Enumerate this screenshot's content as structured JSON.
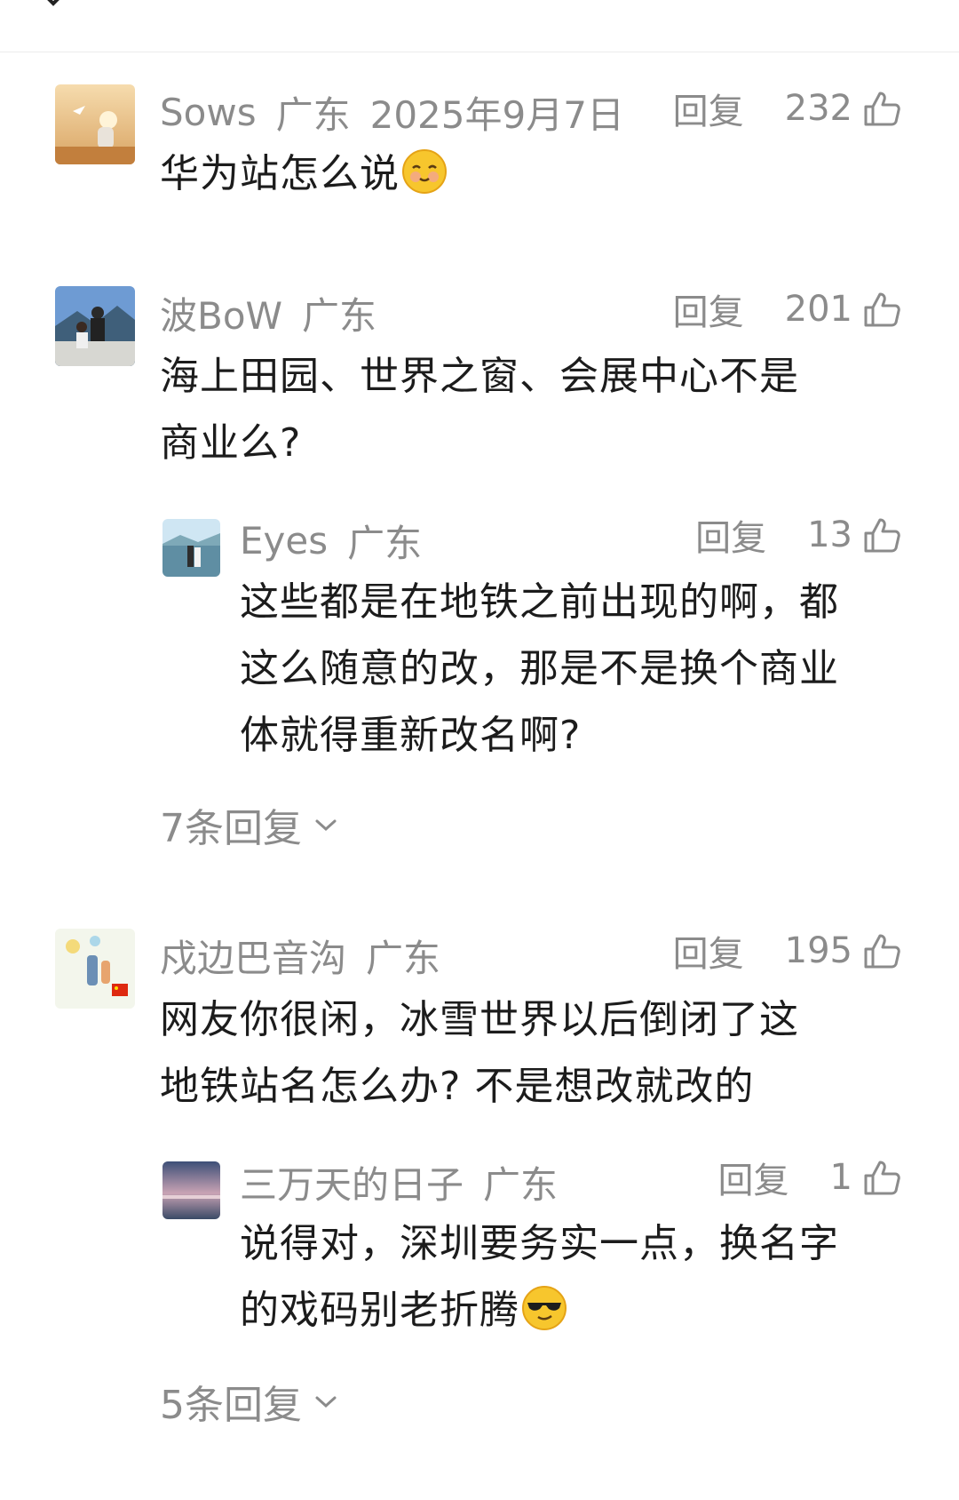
{
  "comments": [
    {
      "user": "Sows",
      "location": "广东",
      "date": "2025年9月7日",
      "reply_label": "回复",
      "likes": "232",
      "text": "华为站怎么说",
      "emoji": "smiling-face-emoji"
    },
    {
      "user": "波BoW",
      "location": "广东",
      "reply_label": "回复",
      "likes": "201",
      "text_lines": [
        "海上田园、世界之窗、会展中心不是",
        "商业么?"
      ],
      "replies": [
        {
          "user": "Eyes",
          "location": "广东",
          "reply_label": "回复",
          "likes": "13",
          "text_lines": [
            "这些都是在地铁之前出现的啊，都",
            "这么随意的改，那是不是换个商业",
            "体就得重新改名啊?"
          ]
        }
      ],
      "more_replies": "7条回复"
    },
    {
      "user": "戍边巴音沟",
      "location": "广东",
      "reply_label": "回复",
      "likes": "195",
      "text_lines": [
        "网友你很闲，冰雪世界以后倒闭了这",
        "地铁站名怎么办? 不是想改就改的"
      ],
      "replies": [
        {
          "user": "三万天的日子",
          "location": "广东",
          "reply_label": "回复",
          "likes": "1",
          "text_lines": [
            "说得对，深圳要务实一点，换名字",
            "的戏码别老折腾"
          ],
          "emoji": "sunglasses-emoji"
        }
      ],
      "more_replies": "5条回复"
    }
  ],
  "icons": {
    "close": "close-icon",
    "like": "thumbs-up-icon",
    "expand": "chevron-down-icon"
  },
  "colors": {
    "meta_text": "#8b8b8b",
    "body_text": "#1c1c1c",
    "divider": "#ececec"
  }
}
